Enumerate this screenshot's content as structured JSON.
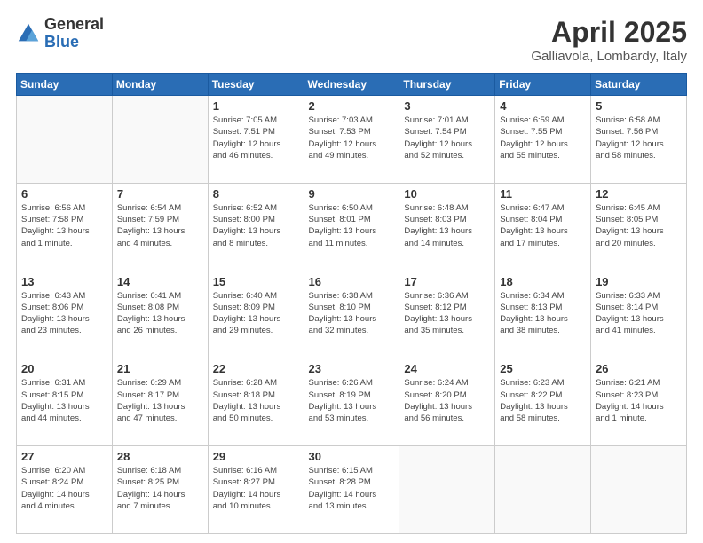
{
  "logo": {
    "general": "General",
    "blue": "Blue"
  },
  "header": {
    "month": "April 2025",
    "location": "Galliavola, Lombardy, Italy"
  },
  "weekdays": [
    "Sunday",
    "Monday",
    "Tuesday",
    "Wednesday",
    "Thursday",
    "Friday",
    "Saturday"
  ],
  "weeks": [
    [
      {
        "day": "",
        "info": ""
      },
      {
        "day": "",
        "info": ""
      },
      {
        "day": "1",
        "info": "Sunrise: 7:05 AM\nSunset: 7:51 PM\nDaylight: 12 hours\nand 46 minutes."
      },
      {
        "day": "2",
        "info": "Sunrise: 7:03 AM\nSunset: 7:53 PM\nDaylight: 12 hours\nand 49 minutes."
      },
      {
        "day": "3",
        "info": "Sunrise: 7:01 AM\nSunset: 7:54 PM\nDaylight: 12 hours\nand 52 minutes."
      },
      {
        "day": "4",
        "info": "Sunrise: 6:59 AM\nSunset: 7:55 PM\nDaylight: 12 hours\nand 55 minutes."
      },
      {
        "day": "5",
        "info": "Sunrise: 6:58 AM\nSunset: 7:56 PM\nDaylight: 12 hours\nand 58 minutes."
      }
    ],
    [
      {
        "day": "6",
        "info": "Sunrise: 6:56 AM\nSunset: 7:58 PM\nDaylight: 13 hours\nand 1 minute."
      },
      {
        "day": "7",
        "info": "Sunrise: 6:54 AM\nSunset: 7:59 PM\nDaylight: 13 hours\nand 4 minutes."
      },
      {
        "day": "8",
        "info": "Sunrise: 6:52 AM\nSunset: 8:00 PM\nDaylight: 13 hours\nand 8 minutes."
      },
      {
        "day": "9",
        "info": "Sunrise: 6:50 AM\nSunset: 8:01 PM\nDaylight: 13 hours\nand 11 minutes."
      },
      {
        "day": "10",
        "info": "Sunrise: 6:48 AM\nSunset: 8:03 PM\nDaylight: 13 hours\nand 14 minutes."
      },
      {
        "day": "11",
        "info": "Sunrise: 6:47 AM\nSunset: 8:04 PM\nDaylight: 13 hours\nand 17 minutes."
      },
      {
        "day": "12",
        "info": "Sunrise: 6:45 AM\nSunset: 8:05 PM\nDaylight: 13 hours\nand 20 minutes."
      }
    ],
    [
      {
        "day": "13",
        "info": "Sunrise: 6:43 AM\nSunset: 8:06 PM\nDaylight: 13 hours\nand 23 minutes."
      },
      {
        "day": "14",
        "info": "Sunrise: 6:41 AM\nSunset: 8:08 PM\nDaylight: 13 hours\nand 26 minutes."
      },
      {
        "day": "15",
        "info": "Sunrise: 6:40 AM\nSunset: 8:09 PM\nDaylight: 13 hours\nand 29 minutes."
      },
      {
        "day": "16",
        "info": "Sunrise: 6:38 AM\nSunset: 8:10 PM\nDaylight: 13 hours\nand 32 minutes."
      },
      {
        "day": "17",
        "info": "Sunrise: 6:36 AM\nSunset: 8:12 PM\nDaylight: 13 hours\nand 35 minutes."
      },
      {
        "day": "18",
        "info": "Sunrise: 6:34 AM\nSunset: 8:13 PM\nDaylight: 13 hours\nand 38 minutes."
      },
      {
        "day": "19",
        "info": "Sunrise: 6:33 AM\nSunset: 8:14 PM\nDaylight: 13 hours\nand 41 minutes."
      }
    ],
    [
      {
        "day": "20",
        "info": "Sunrise: 6:31 AM\nSunset: 8:15 PM\nDaylight: 13 hours\nand 44 minutes."
      },
      {
        "day": "21",
        "info": "Sunrise: 6:29 AM\nSunset: 8:17 PM\nDaylight: 13 hours\nand 47 minutes."
      },
      {
        "day": "22",
        "info": "Sunrise: 6:28 AM\nSunset: 8:18 PM\nDaylight: 13 hours\nand 50 minutes."
      },
      {
        "day": "23",
        "info": "Sunrise: 6:26 AM\nSunset: 8:19 PM\nDaylight: 13 hours\nand 53 minutes."
      },
      {
        "day": "24",
        "info": "Sunrise: 6:24 AM\nSunset: 8:20 PM\nDaylight: 13 hours\nand 56 minutes."
      },
      {
        "day": "25",
        "info": "Sunrise: 6:23 AM\nSunset: 8:22 PM\nDaylight: 13 hours\nand 58 minutes."
      },
      {
        "day": "26",
        "info": "Sunrise: 6:21 AM\nSunset: 8:23 PM\nDaylight: 14 hours\nand 1 minute."
      }
    ],
    [
      {
        "day": "27",
        "info": "Sunrise: 6:20 AM\nSunset: 8:24 PM\nDaylight: 14 hours\nand 4 minutes."
      },
      {
        "day": "28",
        "info": "Sunrise: 6:18 AM\nSunset: 8:25 PM\nDaylight: 14 hours\nand 7 minutes."
      },
      {
        "day": "29",
        "info": "Sunrise: 6:16 AM\nSunset: 8:27 PM\nDaylight: 14 hours\nand 10 minutes."
      },
      {
        "day": "30",
        "info": "Sunrise: 6:15 AM\nSunset: 8:28 PM\nDaylight: 14 hours\nand 13 minutes."
      },
      {
        "day": "",
        "info": ""
      },
      {
        "day": "",
        "info": ""
      },
      {
        "day": "",
        "info": ""
      }
    ]
  ]
}
